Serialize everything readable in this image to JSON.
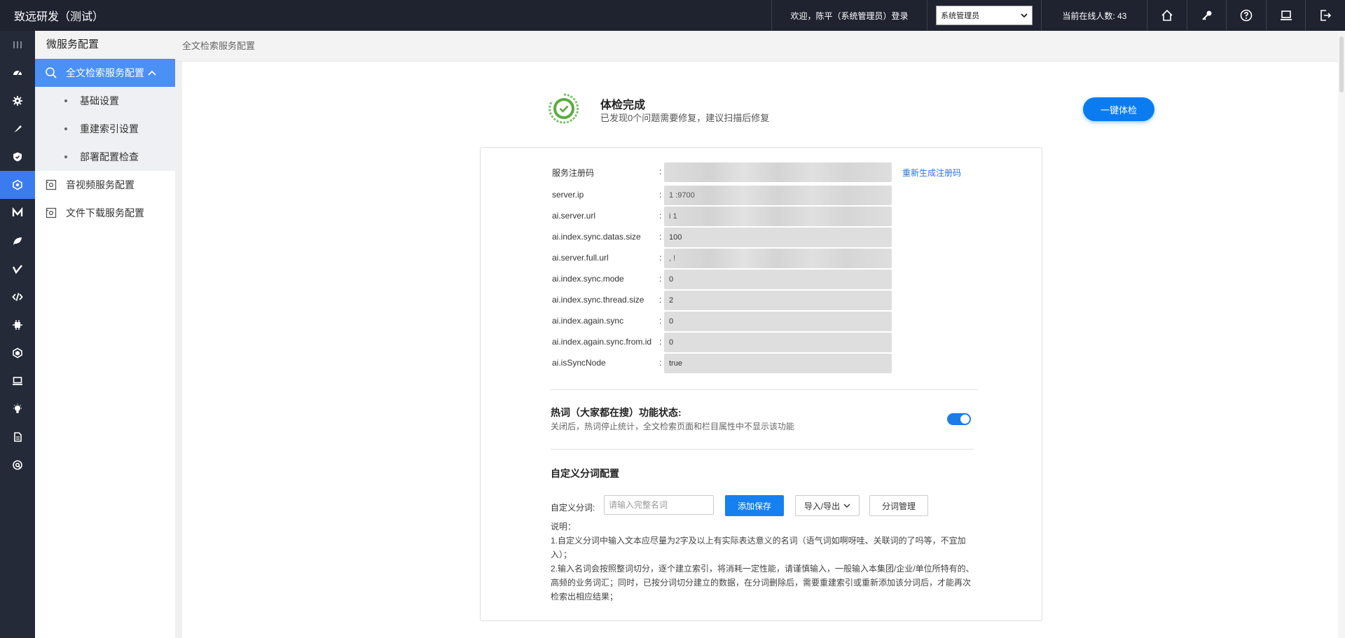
{
  "app": {
    "title": "致远研发（测试）"
  },
  "topbar": {
    "welcome": "欢迎，陈平（系统管理员）登录",
    "role_select": "系统管理员",
    "online": "当前在线人数: 43",
    "icons": [
      "home-icon",
      "key-icon",
      "help-icon",
      "monitor-icon",
      "logout-icon"
    ]
  },
  "rail": {
    "icons": [
      "menu-icon",
      "dashboard-icon",
      "settings-icon",
      "brush-icon",
      "shield-icon",
      "microservice-icon",
      "m-icon",
      "leaf-icon",
      "v-icon",
      "code-icon",
      "plugin-icon",
      "hexagon-icon",
      "screen-icon",
      "bulb-icon",
      "doc-icon",
      "at-icon"
    ],
    "active_index": 5
  },
  "sidebar": {
    "title": "微服务配置",
    "group": {
      "label": "全文检索服务配置"
    },
    "sub_items": [
      {
        "label": "基础设置"
      },
      {
        "label": "重建索引设置"
      },
      {
        "label": "部署配置检查"
      }
    ],
    "items": [
      {
        "label": "音视频服务配置"
      },
      {
        "label": "文件下载服务配置"
      }
    ]
  },
  "breadcrumb": "全文检索服务配置",
  "check": {
    "title": "体检完成",
    "subtitle": "已发现0个问题需要修复，建议扫描后修复",
    "button": "一键体检"
  },
  "form": {
    "colon": ":",
    "fields": [
      {
        "label": "服务注册码",
        "value": ""
      },
      {
        "label": "server.ip",
        "value": "1          :9700"
      },
      {
        "label": "ai.server.url",
        "value": "i                                      1"
      },
      {
        "label": "ai.index.sync.datas.size",
        "value": "100"
      },
      {
        "label": "ai.server.full.url",
        "value": ",                                      !"
      },
      {
        "label": "ai.index.sync.mode",
        "value": "0"
      },
      {
        "label": "ai.index.sync.thread.size",
        "value": "2"
      },
      {
        "label": "ai.index.again.sync",
        "value": "0"
      },
      {
        "label": "ai.index.again.sync.from.id",
        "value": "0"
      },
      {
        "label": "ai.isSyncNode",
        "value": "true"
      }
    ],
    "regen_link": "重新生成注册码"
  },
  "hotword": {
    "title": "热词（大家都在搜）功能状态:",
    "subtitle": "关闭后，热词停止统计，全文检索页面和栏目属性中不显示该功能",
    "enabled": true
  },
  "custom": {
    "title": "自定义分词配置",
    "label": "自定义分词:",
    "placeholder": "请输入完整名词",
    "add_button": "添加保存",
    "io_button": "导入/导出",
    "manage_button": "分词管理",
    "notes": [
      "说明：",
      "1.自定义分词中输入文本应尽量为2字及以上有实际表达意义的名词（语气词如啊呀哇、关联词的了吗等，不宜加入）；",
      "2.输入名词会按照整词切分，逐个建立索引，将消耗一定性能，请谨慎输入，一般输入本集团/企业/单位所特有的、高频的业务词汇；同时，已按分词切分建立的数据，在分词删除后，需要重建索引或重新添加该分词后，才能再次检索出相应结果；"
    ]
  },
  "colors": {
    "accent": "#1580f0",
    "sidebar_active": "#4a90f5",
    "topbar": "#1f2330",
    "rail": "#242a38"
  }
}
